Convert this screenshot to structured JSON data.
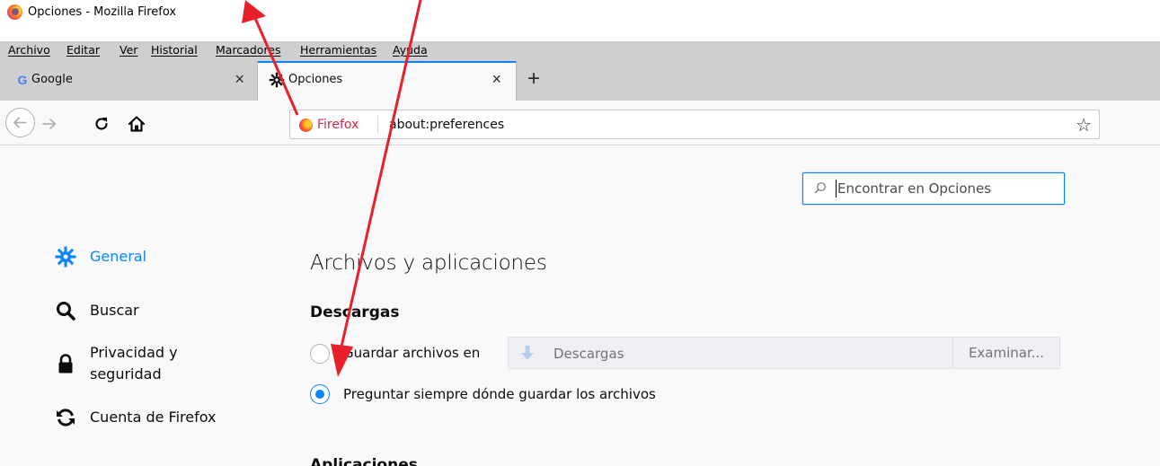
{
  "window": {
    "title": "Opciones - Mozilla Firefox"
  },
  "menu": {
    "items": [
      {
        "label": "Archivo"
      },
      {
        "label": "Editar"
      },
      {
        "label": "Ver"
      },
      {
        "label": "Historial"
      },
      {
        "label": "Marcadores"
      },
      {
        "label": "Herramientas"
      },
      {
        "label": "Ayuda"
      }
    ]
  },
  "tabs": [
    {
      "label": "Google",
      "icon": "google-icon",
      "active": false
    },
    {
      "label": "Opciones",
      "icon": "gear-icon",
      "active": true
    }
  ],
  "tab_close_glyph": "×",
  "new_tab_glyph": "+",
  "urlbar": {
    "identity_label": "Firefox",
    "url": "about:preferences"
  },
  "search": {
    "placeholder": "Encontrar en Opciones"
  },
  "sidebar": {
    "items": [
      {
        "label": "General",
        "icon": "gear-icon",
        "selected": true
      },
      {
        "label": "Buscar",
        "icon": "search-icon",
        "selected": false
      },
      {
        "label": "Privacidad y seguridad",
        "icon": "lock-icon",
        "selected": false
      },
      {
        "label": "Cuenta de Firefox",
        "icon": "sync-icon",
        "selected": false
      }
    ]
  },
  "main": {
    "section_title": "Archivos y aplicaciones",
    "downloads_heading": "Descargas",
    "save_files_label": "Guardar archivos en",
    "folder_value": "Descargas",
    "browse_button": "Examinar...",
    "always_ask_label": "Preguntar siempre dónde guardar los archivos",
    "selected_option": "always_ask",
    "applications_heading": "Aplicaciones"
  },
  "colors": {
    "accent": "#0a84ff",
    "annotation_arrow": "#e8202a"
  }
}
